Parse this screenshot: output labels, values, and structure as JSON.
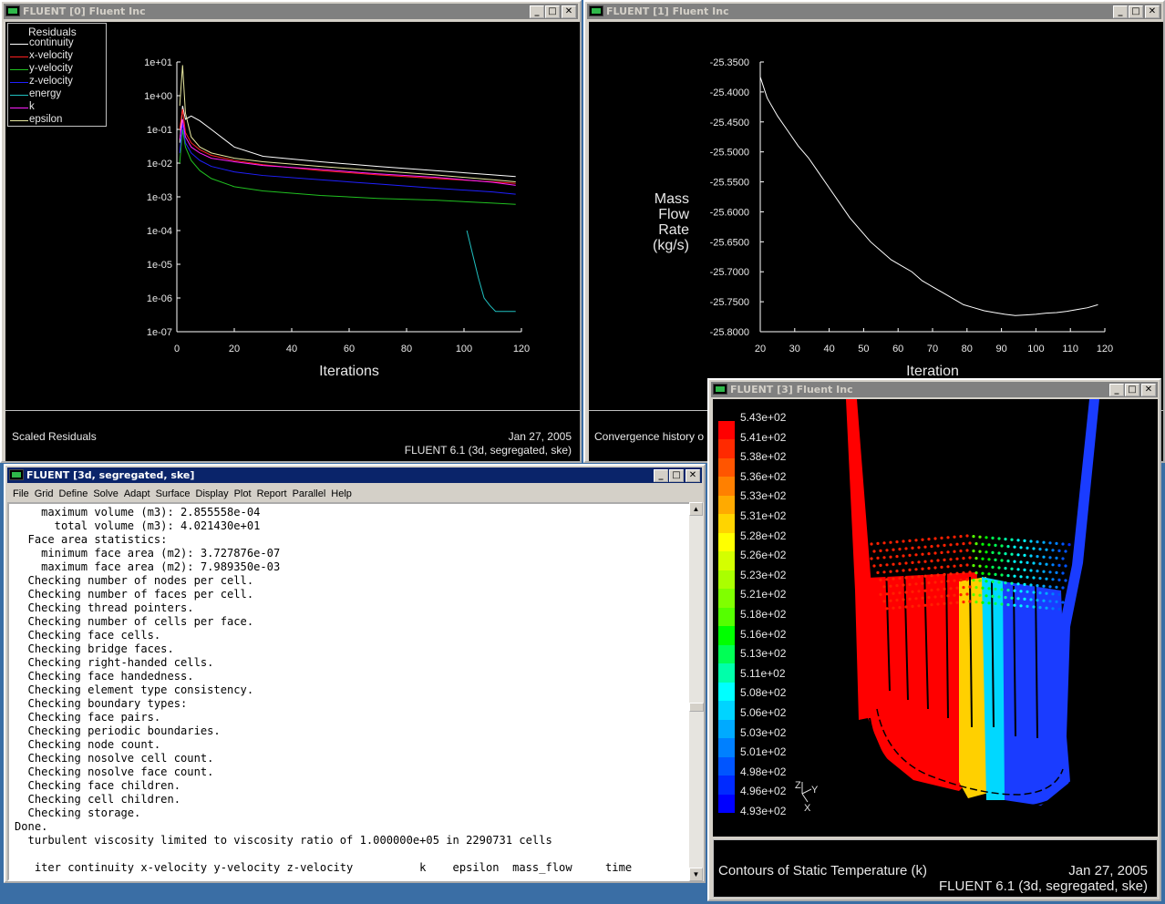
{
  "win0": {
    "title": "FLUENT [0] Fluent Inc",
    "legend_title": "Residuals",
    "legend": [
      {
        "label": "continuity",
        "color": "#ffffff"
      },
      {
        "label": "x-velocity",
        "color": "#ff2020"
      },
      {
        "label": "y-velocity",
        "color": "#20c020"
      },
      {
        "label": "z-velocity",
        "color": "#2020ff"
      },
      {
        "label": "energy",
        "color": "#20c0c0"
      },
      {
        "label": "k",
        "color": "#ff20ff"
      },
      {
        "label": "epsilon",
        "color": "#e8e8a0"
      }
    ],
    "status_left": "Scaled Residuals",
    "status_date": "Jan 27, 2005",
    "status_version": "FLUENT 6.1 (3d, segregated, ske)"
  },
  "win1": {
    "title": "FLUENT [1] Fluent Inc",
    "status_left": "Convergence history o"
  },
  "win3": {
    "title": "FLUENT [3] Fluent Inc",
    "colorbar_labels": [
      "5.43e+02",
      "5.41e+02",
      "5.38e+02",
      "5.36e+02",
      "5.33e+02",
      "5.31e+02",
      "5.28e+02",
      "5.26e+02",
      "5.23e+02",
      "5.21e+02",
      "5.18e+02",
      "5.16e+02",
      "5.13e+02",
      "5.11e+02",
      "5.08e+02",
      "5.06e+02",
      "5.03e+02",
      "5.01e+02",
      "4.98e+02",
      "4.96e+02",
      "4.93e+02"
    ],
    "colorbar_colors": [
      "#ff0000",
      "#ff2a00",
      "#ff5500",
      "#ff8000",
      "#ffaa00",
      "#ffd400",
      "#ffff00",
      "#d4ff00",
      "#aaff00",
      "#80ff00",
      "#55ff00",
      "#00ff00",
      "#00ff55",
      "#00ffaa",
      "#00ffff",
      "#00d4ff",
      "#00aaff",
      "#0080ff",
      "#0055ff",
      "#002aff",
      "#0000ff"
    ],
    "axes": {
      "z": "Z",
      "y": "Y",
      "x": "X"
    },
    "status_left": "Contours of Static Temperature (k)",
    "status_date": "Jan 27, 2005",
    "status_version": "FLUENT 6.1 (3d, segregated, ske)"
  },
  "console_win": {
    "title": "FLUENT  [3d, segregated, ske]",
    "menu": [
      "File",
      "Grid",
      "Define",
      "Solve",
      "Adapt",
      "Surface",
      "Display",
      "Plot",
      "Report",
      "Parallel",
      "Help"
    ],
    "lines": [
      "    maximum volume (m3): 2.855558e-04",
      "      total volume (m3): 4.021430e+01",
      "  Face area statistics:",
      "    minimum face area (m2): 3.727876e-07",
      "    maximum face area (m2): 7.989350e-03",
      "  Checking number of nodes per cell.",
      "  Checking number of faces per cell.",
      "  Checking thread pointers.",
      "  Checking number of cells per face.",
      "  Checking face cells.",
      "  Checking bridge faces.",
      "  Checking right-handed cells.",
      "  Checking face handedness.",
      "  Checking element type consistency.",
      "  Checking boundary types:",
      "  Checking face pairs.",
      "  Checking periodic boundaries.",
      "  Checking node count.",
      "  Checking nosolve cell count.",
      "  Checking nosolve face count.",
      "  Checking face children.",
      "  Checking cell children.",
      "  Checking storage.",
      "Done.",
      "  turbulent viscosity limited to viscosity ratio of 1.000000e+05 in 2290731 cells",
      "",
      "   iter continuity x-velocity y-velocity z-velocity          k    epsilon  mass_flow     time"
    ]
  },
  "chart_data": [
    {
      "type": "line",
      "title": "Residuals",
      "xlabel": "Iterations",
      "ylabel": "",
      "xlim": [
        0,
        120
      ],
      "ylim": [
        1e-07,
        10
      ],
      "yscale": "log",
      "x_ticks": [
        "0",
        "20",
        "40",
        "60",
        "80",
        "100",
        "120"
      ],
      "y_ticks": [
        "1e+01",
        "1e+00",
        "1e-01",
        "1e-02",
        "1e-03",
        "1e-04",
        "1e-05",
        "1e-06",
        "1e-07"
      ],
      "series": [
        {
          "name": "continuity",
          "color": "#ffffff",
          "x": [
            1,
            2,
            3,
            5,
            8,
            12,
            20,
            30,
            50,
            70,
            90,
            110,
            118
          ],
          "y": [
            0.04,
            0.5,
            0.2,
            0.25,
            0.18,
            0.1,
            0.03,
            0.016,
            0.011,
            0.008,
            0.006,
            0.0045,
            0.004
          ]
        },
        {
          "name": "x-velocity",
          "color": "#ff2020",
          "x": [
            1,
            2,
            3,
            5,
            8,
            12,
            20,
            30,
            50,
            70,
            90,
            110,
            118
          ],
          "y": [
            0.1,
            0.4,
            0.08,
            0.04,
            0.025,
            0.017,
            0.012,
            0.009,
            0.006,
            0.0045,
            0.0035,
            0.0028,
            0.0025
          ]
        },
        {
          "name": "y-velocity",
          "color": "#20c020",
          "x": [
            1,
            2,
            3,
            5,
            8,
            12,
            20,
            30,
            50,
            70,
            90,
            110,
            118
          ],
          "y": [
            0.01,
            0.1,
            0.03,
            0.012,
            0.006,
            0.0035,
            0.002,
            0.0015,
            0.0011,
            0.0009,
            0.0008,
            0.00065,
            0.0006
          ]
        },
        {
          "name": "z-velocity",
          "color": "#2020ff",
          "x": [
            1,
            2,
            3,
            5,
            8,
            12,
            20,
            30,
            50,
            70,
            90,
            110,
            118
          ],
          "y": [
            0.02,
            0.15,
            0.04,
            0.02,
            0.012,
            0.008,
            0.0055,
            0.0043,
            0.0032,
            0.0024,
            0.0018,
            0.0014,
            0.0012
          ]
        },
        {
          "name": "energy",
          "color": "#20c0c0",
          "x": [
            101,
            103,
            105,
            107,
            109,
            111,
            118
          ],
          "y": [
            0.0001,
            2e-05,
            4e-06,
            1e-06,
            6e-07,
            4e-07,
            4e-07
          ]
        },
        {
          "name": "k",
          "color": "#ff20ff",
          "x": [
            1,
            2,
            3,
            5,
            8,
            12,
            20,
            30,
            50,
            70,
            90,
            110,
            118
          ],
          "y": [
            0.05,
            0.2,
            0.06,
            0.03,
            0.02,
            0.014,
            0.011,
            0.0085,
            0.0065,
            0.0048,
            0.0038,
            0.0027,
            0.0022
          ]
        },
        {
          "name": "epsilon",
          "color": "#e8e8a0",
          "x": [
            1,
            2,
            3,
            5,
            8,
            12,
            20,
            30,
            50,
            70,
            90,
            110,
            118
          ],
          "y": [
            0.5,
            8,
            0.3,
            0.06,
            0.03,
            0.02,
            0.014,
            0.011,
            0.008,
            0.006,
            0.0045,
            0.0032,
            0.0028
          ]
        }
      ]
    },
    {
      "type": "line",
      "title": "",
      "xlabel": "Iteration",
      "ylabel": "Mass Flow Rate (kg/s)",
      "xlim": [
        20,
        120
      ],
      "ylim": [
        -25.8,
        -25.35
      ],
      "x_ticks": [
        "20",
        "30",
        "40",
        "50",
        "60",
        "70",
        "80",
        "90",
        "100",
        "110",
        "120"
      ],
      "y_ticks": [
        "-25.3500",
        "-25.4000",
        "-25.4500",
        "-25.5000",
        "-25.5500",
        "-25.6000",
        "-25.6500",
        "-25.7000",
        "-25.7500",
        "-25.8000"
      ],
      "series": [
        {
          "color": "#ffffff",
          "x": [
            20,
            22,
            25,
            28,
            31,
            34,
            37,
            40,
            43,
            46,
            49,
            52,
            55,
            58,
            61,
            64,
            67,
            70,
            73,
            76,
            79,
            82,
            85,
            88,
            91,
            94,
            97,
            100,
            103,
            106,
            109,
            112,
            115,
            118
          ],
          "y": [
            -25.375,
            -25.41,
            -25.44,
            -25.465,
            -25.49,
            -25.51,
            -25.535,
            -25.56,
            -25.585,
            -25.61,
            -25.63,
            -25.65,
            -25.665,
            -25.68,
            -25.69,
            -25.7,
            -25.715,
            -25.725,
            -25.735,
            -25.745,
            -25.755,
            -25.76,
            -25.765,
            -25.768,
            -25.771,
            -25.773,
            -25.772,
            -25.771,
            -25.769,
            -25.768,
            -25.766,
            -25.763,
            -25.76,
            -25.755
          ]
        }
      ]
    }
  ]
}
